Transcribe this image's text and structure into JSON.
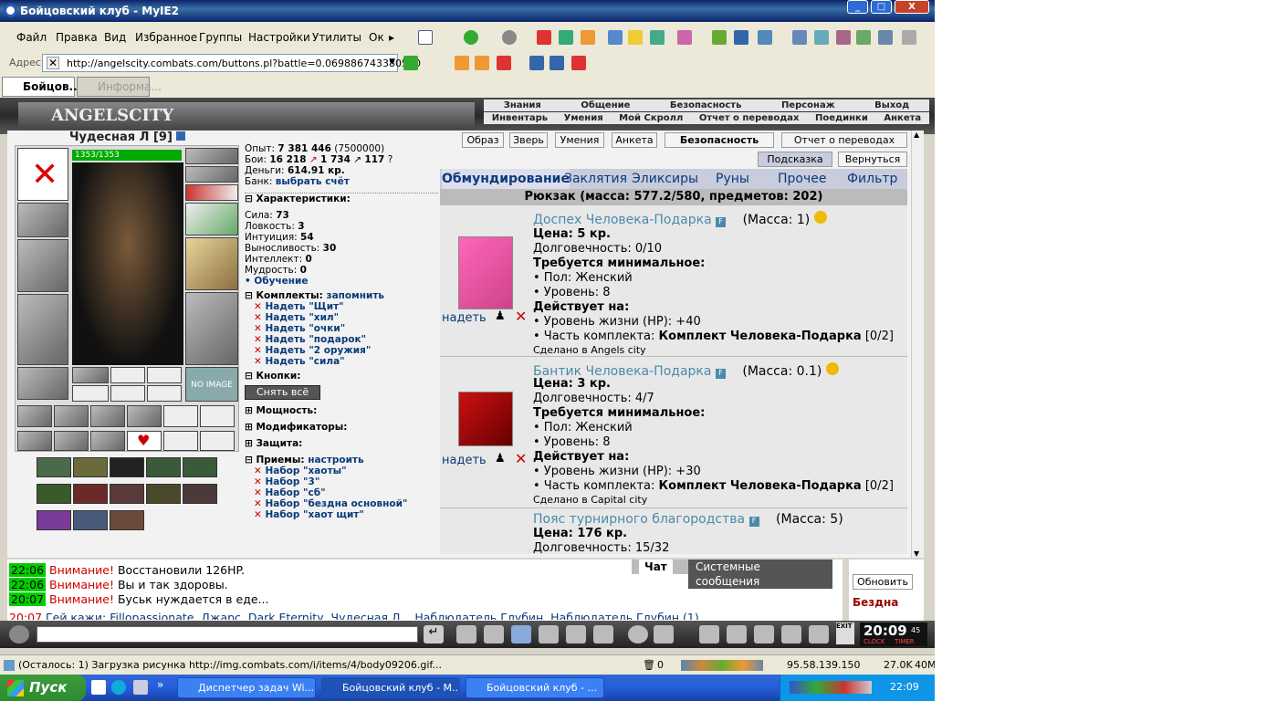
{
  "window": {
    "title": "Бойцовский клуб - MyIE2",
    "min": "_",
    "max": "□",
    "close": "X"
  },
  "menu": [
    "Файл",
    "Правка",
    "Вид",
    "Избранное",
    "Группы",
    "Настройки",
    "Утилиты",
    "Ок"
  ],
  "address": {
    "label": "Адрес",
    "url": "http://angelscity.combats.com/buttons.pl?battle=0.069886743380550"
  },
  "browser_tabs": [
    {
      "label": "Бойцов..."
    },
    {
      "label": "Информа..."
    }
  ],
  "game": {
    "logo": "ANGELSCITY",
    "nav_top": [
      "Знания",
      "Общение",
      "Безопасность",
      "Персонаж",
      "Выход"
    ],
    "nav_bottom": [
      "Инвентарь",
      "Умения",
      "Мой Скролл",
      "Отчет о переводах",
      "Поединки",
      "Анкета"
    ],
    "character": {
      "name": "Чудесная Л",
      "level": "[9]",
      "hp": "1353/1353",
      "hp_fraction": 1.0,
      "no_image": "NO IMAGE"
    },
    "stats": {
      "exp_label": "Опыт:",
      "exp": "7 381 446",
      "exp_next": "(7500000)",
      "fights_label": "Бои:",
      "wins": "16 218",
      "losses": "1 734",
      "draws": "117",
      "money_label": "Деньги:",
      "money": "614.91 кр.",
      "bank_label": "Банк:",
      "bank_link": "выбрать счёт"
    },
    "chars_header": "Характеристики:",
    "chars": [
      {
        "name": "Сила:",
        "value": "73"
      },
      {
        "name": "Ловкость:",
        "value": "3"
      },
      {
        "name": "Интуиция:",
        "value": "54"
      },
      {
        "name": "Выносливость:",
        "value": "30"
      },
      {
        "name": "Интеллект:",
        "value": "0"
      },
      {
        "name": "Мудрость:",
        "value": "0"
      }
    ],
    "training": "Обучение",
    "sets_header": "Комплекты:",
    "sets_remember": "запомнить",
    "sets": [
      "Надеть \"Щит\"",
      "Надеть \"хил\"",
      "Надеть \"очки\"",
      "Надеть \"подарок\"",
      "Надеть \"2 оружия\"",
      "Надеть \"сила\""
    ],
    "buttons_header": "Кнопки:",
    "remove_all": "Снять всё",
    "power_header": "Мощность:",
    "modifiers_header": "Модификаторы:",
    "protection_header": "Защита:",
    "tricks_header": "Приемы:",
    "tricks_setup": "настроить",
    "tricks": [
      "Набор \"хаоты\"",
      "Набор \"3\"",
      "Набор \"сб\"",
      "Набор \"бездна основной\"",
      "Набор \"хаот щит\""
    ],
    "top_buttons": [
      "Образ",
      "Зверь",
      "Умения",
      "Анкета",
      "Безопасность",
      "Отчет о переводах"
    ],
    "hint": "Подсказка",
    "back": "Вернуться",
    "inv_tabs": [
      "Обмундирование",
      "Заклятия",
      "Эликсиры",
      "Руны",
      "Прочее",
      "Фильтр"
    ],
    "backpack": "Рюкзак (масса: 577.2/580, предметов: 202)",
    "wear": "надеть",
    "items": [
      {
        "name": "Доспех Человека-Подарка",
        "mass": "(Масса: 1)",
        "price": "Цена: 5 кр.",
        "durability": "Долговечность: 0/10",
        "req": "Требуется минимальное:",
        "req1": "• Пол: Женский",
        "req2": "• Уровень: 8",
        "acts": "Действует на:",
        "act1": "• Уровень жизни (HP): +40",
        "set_prefix": "• Часть комплекта: ",
        "set": "Комплект Человека-Подарка",
        "set_count": "[0/2]",
        "made": "Сделано в Angels city"
      },
      {
        "name": "Бантик Человека-Подарка",
        "mass": "(Масса: 0.1)",
        "price": "Цена: 3 кр.",
        "durability": "Долговечность: 4/7",
        "req": "Требуется минимальное:",
        "req1": "• Пол: Женский",
        "req2": "• Уровень: 8",
        "acts": "Действует на:",
        "act1": "• Уровень жизни (HP): +30",
        "set_prefix": "• Часть комплекта: ",
        "set": "Комплект Человека-Подарка",
        "set_count": "[0/2]",
        "made": "Сделано в Capital city"
      },
      {
        "name": "Пояс турнирного благородства",
        "mass": "(Масса: 5)",
        "price": "Цена: 176 кр.",
        "durability": "Долговечность: 15/32"
      }
    ],
    "chat": [
      {
        "time": "22:06",
        "warn": "Внимание!",
        "text": "Восстановили 126HP."
      },
      {
        "time": "22:06",
        "warn": "Внимание!",
        "text": "Вы и так здоровы."
      },
      {
        "time": "20:07",
        "warn": "Внимание!",
        "text": "Буськ нуждается в еде..."
      },
      {
        "time": "20:07",
        "warn": "",
        "text": "Гей кажи: Fillopassionate, Джарс, Dark Eternity, Чудесная Л... Наблюдатель Глубин, Наблюдатель Глубин (1)"
      }
    ],
    "chat_tabs": [
      "Чат",
      "Системные сообщения"
    ],
    "refresh": "Обновить",
    "room": "Бездна",
    "clock": {
      "time": "20:09",
      "sec": "45",
      "clock_label": "CLOCK",
      "timer_label": "TIMER",
      "exit": "EXIT"
    }
  },
  "status": {
    "text": "(Осталось: 1) Загрузка рисунка http://img.combats.com/i/items/4/body09206.gif...",
    "count": "0",
    "ip": "95.58.139.150",
    "size": "27.0K",
    "mem": "40M"
  },
  "taskbar": {
    "start": "Пуск",
    "tasks": [
      "Диспетчер задач Wi...",
      "Бойцовский клуб - M...",
      "Бойцовский клуб - ..."
    ],
    "clock": "22:09"
  }
}
